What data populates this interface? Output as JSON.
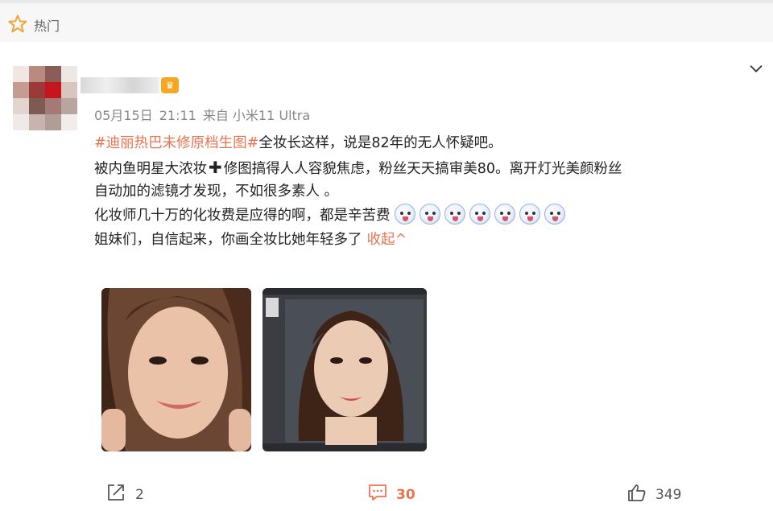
{
  "top_bar": {
    "label": "热门",
    "icon": "star-outline-icon"
  },
  "post": {
    "meta": {
      "date": "05月15日",
      "time": "21:11",
      "source": "来自 小米11 Ultra"
    },
    "lines": {
      "line1_hashtag": "#迪丽热巴未修原档生图#",
      "line1_rest": "全妆长这样，说是82年的无人怀疑吧。",
      "line2_a": "被内鱼明星大浓妆",
      "line2_b": "修图搞得人人容貌焦虑，粉丝天天搞审美80。离开灯光美颜粉丝",
      "line3": "自动加的滤镜才发现，不如很多素人 。",
      "line4": "化妆师几十万的化妆费是应得的啊，都是辛苦费",
      "line5": "姐妹们，自信起来，你画全妆比她年轻多了",
      "collapse": "收起^"
    },
    "emoji_count": 7
  },
  "actions": {
    "share_count": "2",
    "comment_count": "30",
    "like_count": "349"
  },
  "colors": {
    "accent": "#eb7350",
    "muted": "#888888"
  }
}
